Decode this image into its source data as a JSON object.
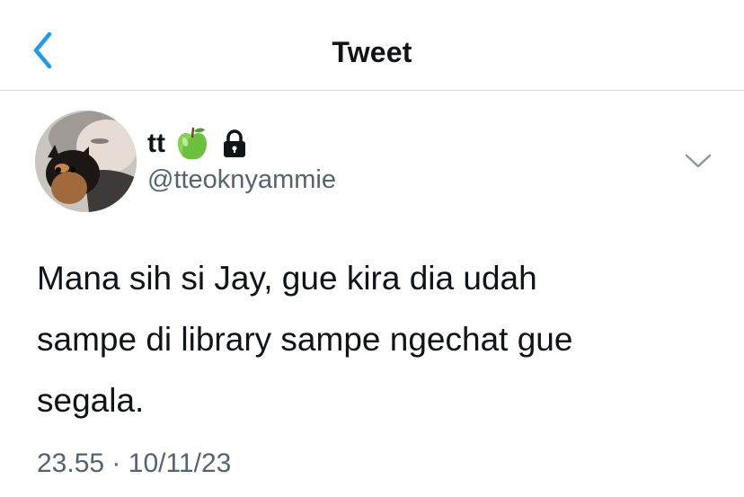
{
  "header": {
    "title": "Tweet",
    "back_icon": "chevron-left-icon",
    "accent_color": "#1d9bf0"
  },
  "tweet": {
    "author": {
      "display_name": "tt",
      "badges": [
        "green-apple-icon",
        "lock-icon"
      ],
      "handle": "@tteoknyammie"
    },
    "menu_icon": "chevron-down-icon",
    "text": "Mana sih si Jay, gue kira dia udah\nsampe di library sampe ngechat gue\nsegala.",
    "time": "23.55",
    "separator": "·",
    "date": "10/11/23"
  },
  "colors": {
    "text_primary": "#0f1419",
    "text_secondary": "#536471",
    "divider": "#d9dde1"
  }
}
